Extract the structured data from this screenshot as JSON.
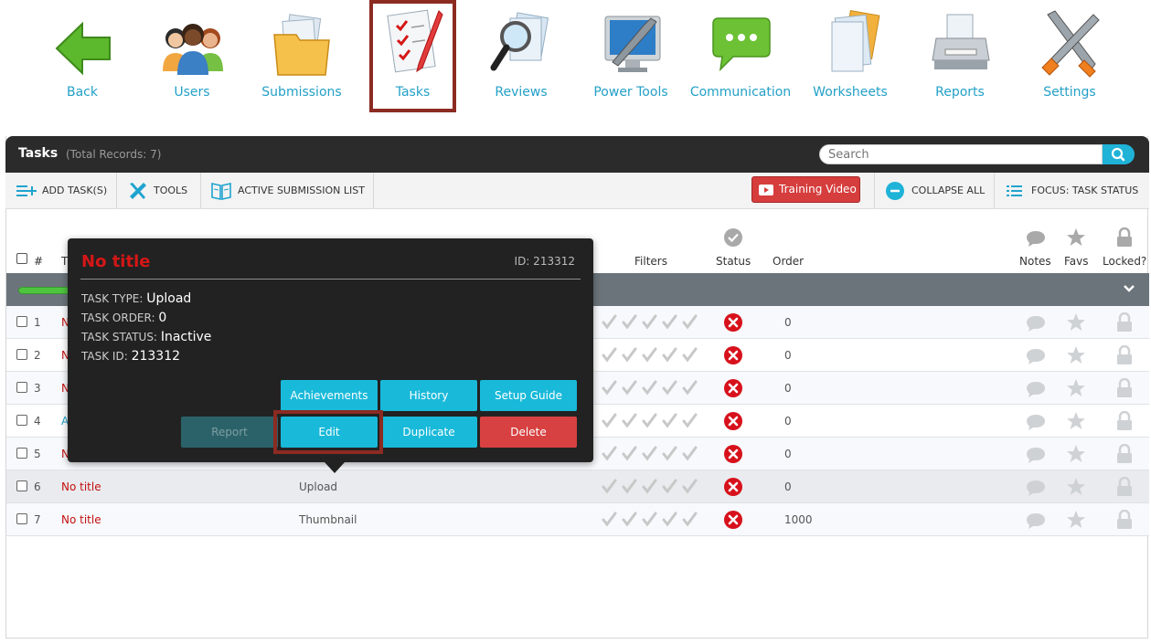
{
  "nav": [
    {
      "label": "Back",
      "icon": "back-arrow-icon"
    },
    {
      "label": "Users",
      "icon": "users-icon"
    },
    {
      "label": "Submissions",
      "icon": "folder-icon"
    },
    {
      "label": "Tasks",
      "icon": "checklist-icon",
      "active": true
    },
    {
      "label": "Reviews",
      "icon": "magnifier-icon"
    },
    {
      "label": "Power Tools",
      "icon": "monitor-wrench-icon"
    },
    {
      "label": "Communication",
      "icon": "chat-bubble-icon"
    },
    {
      "label": "Worksheets",
      "icon": "worksheets-icon"
    },
    {
      "label": "Reports",
      "icon": "printer-icon"
    },
    {
      "label": "Settings",
      "icon": "tools-icon"
    }
  ],
  "panel": {
    "title": "Tasks",
    "count": "(Total Records: 7)",
    "search_placeholder": "Search"
  },
  "toolbar": {
    "add_task": "ADD TASK(S)",
    "tools": "TOOLS",
    "active_submission_list": "ACTIVE SUBMISSION LIST",
    "training_video": "Training Video",
    "collapse_all": "COLLAPSE ALL",
    "focus": "FOCUS: TASK STATUS"
  },
  "columns": {
    "num": "#",
    "title": "T",
    "filters": "Filters",
    "status": "Status",
    "order": "Order",
    "notes": "Notes",
    "favs": "Favs",
    "locked": "Locked?"
  },
  "rows": [
    {
      "num": "1",
      "title": "N",
      "type": "",
      "order": "0"
    },
    {
      "num": "2",
      "title": "N",
      "type": "",
      "order": "0"
    },
    {
      "num": "3",
      "title": "N",
      "type": "",
      "order": "0"
    },
    {
      "num": "4",
      "title": "A",
      "type": "",
      "order": "0"
    },
    {
      "num": "5",
      "title": "N",
      "type": "",
      "order": "0"
    },
    {
      "num": "6",
      "title": "No title",
      "type": "Upload",
      "order": "0"
    },
    {
      "num": "7",
      "title": "No title",
      "type": "Thumbnail",
      "order": "1000"
    }
  ],
  "popup": {
    "title": "No title",
    "id": "ID: 213312",
    "task_type_label": "TASK TYPE:",
    "task_type": "Upload",
    "task_order_label": "TASK ORDER:",
    "task_order": "0",
    "task_status_label": "TASK STATUS:",
    "task_status": "Inactive",
    "task_id_label": "TASK ID:",
    "task_id": "213312",
    "buttons": {
      "achievements": "Achievements",
      "history": "History",
      "setup_guide": "Setup Guide",
      "report": "Report",
      "edit": "Edit",
      "duplicate": "Duplicate",
      "delete": "Delete"
    }
  },
  "colors": {
    "accent": "#1fb3d8",
    "link": "#23a0c7",
    "danger": "#d74141",
    "highlight_border": "#8c2b22"
  }
}
